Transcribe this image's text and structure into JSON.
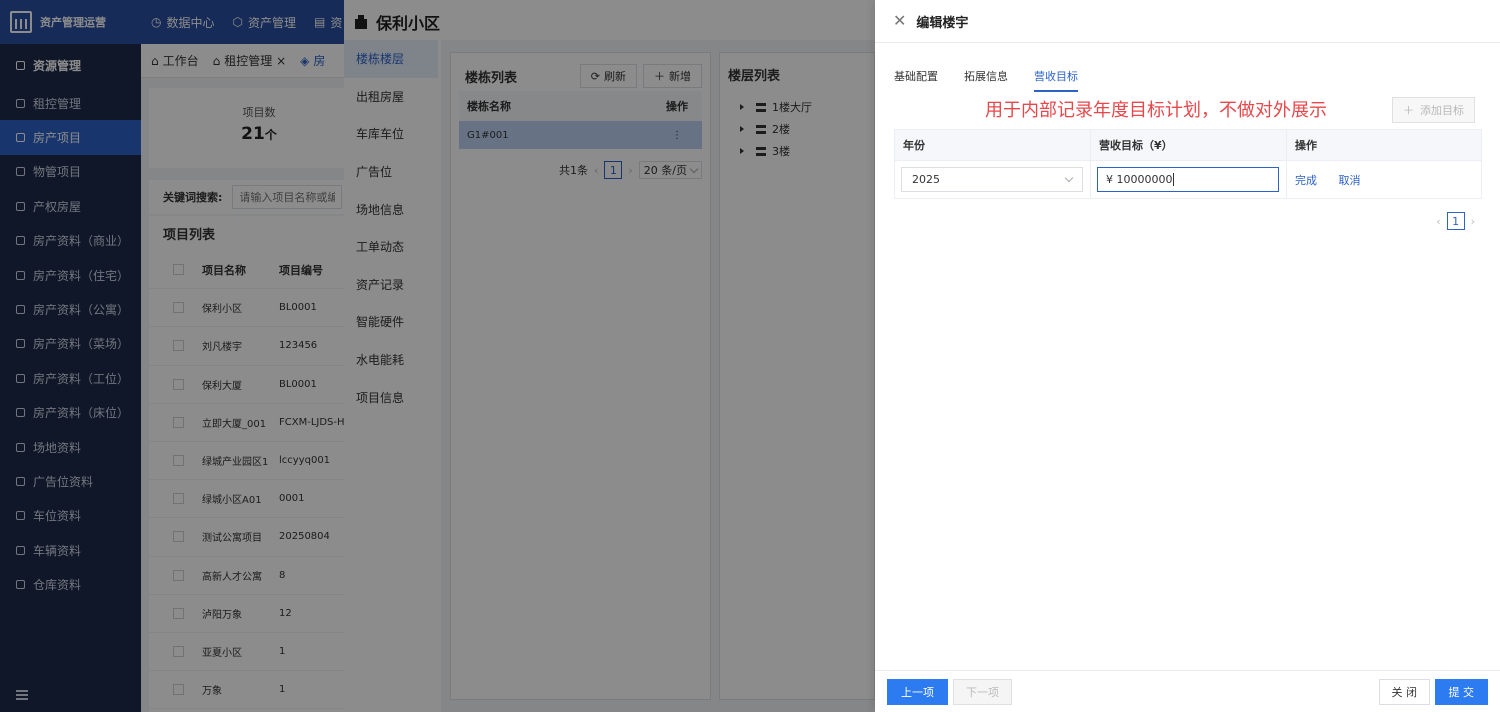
{
  "topbar": {
    "brand": "资产管理运营",
    "nav": [
      "数据中心",
      "资产管理",
      "资"
    ]
  },
  "sidebar": {
    "header": "资源管理",
    "items": [
      {
        "label": "租控管理",
        "active": false
      },
      {
        "label": "房产项目",
        "active": true
      },
      {
        "label": "物管项目",
        "active": false
      },
      {
        "label": "产权房屋",
        "active": false
      },
      {
        "label": "房产资料（商业）",
        "active": false
      },
      {
        "label": "房产资料（住宅）",
        "active": false
      },
      {
        "label": "房产资料（公寓）",
        "active": false
      },
      {
        "label": "房产资料（菜场）",
        "active": false
      },
      {
        "label": "房产资料（工位）",
        "active": false
      },
      {
        "label": "房产资料（床位）",
        "active": false
      },
      {
        "label": "场地资料",
        "active": false
      },
      {
        "label": "广告位资料",
        "active": false
      },
      {
        "label": "车位资料",
        "active": false
      },
      {
        "label": "车辆资料",
        "active": false
      },
      {
        "label": "仓库资料",
        "active": false
      }
    ]
  },
  "content": {
    "tabs": [
      "工作台",
      "租控管理 ×",
      "房"
    ],
    "stats_label": "项目数",
    "stats_value": "21",
    "stats_unit": "个",
    "search_label": "关键词搜索:",
    "search_placeholder": "请输入项目名称或编号",
    "list_title": "项目列表",
    "columns": [
      "项目名称",
      "项目编号"
    ],
    "rows": [
      [
        "保利小区",
        "BL0001"
      ],
      [
        "刘凡楼宇",
        "123456"
      ],
      [
        "保利大厦",
        "BL0001"
      ],
      [
        "立即大厦_001",
        "FCXM-LJDS-HK"
      ],
      [
        "绿城产业园区1",
        "lccyyq001"
      ],
      [
        "绿城小区A01",
        "0001"
      ],
      [
        "测试公寓项目",
        "20250804"
      ],
      [
        "高新人才公寓",
        "8"
      ],
      [
        "泸阳万象",
        "12"
      ],
      [
        "亚夏小区",
        "1"
      ],
      [
        "万象",
        "1"
      ]
    ]
  },
  "midpanel": {
    "title": "保利小区",
    "nav": [
      {
        "label": "楼栋楼层",
        "active": true
      },
      {
        "label": "出租房屋",
        "active": false
      },
      {
        "label": "车库车位",
        "active": false
      },
      {
        "label": "广告位",
        "active": false
      },
      {
        "label": "场地信息",
        "active": false
      },
      {
        "label": "工单动态",
        "active": false
      },
      {
        "label": "资产记录",
        "active": false
      },
      {
        "label": "智能硬件",
        "active": false
      },
      {
        "label": "水电能耗",
        "active": false
      },
      {
        "label": "项目信息",
        "active": false
      }
    ],
    "building_list_title": "楼栋列表",
    "refresh": "刷新",
    "add": "新增",
    "col_name": "楼栋名称",
    "col_op": "操作",
    "building_row": "G1#001",
    "row_op": "⋮",
    "total": "共1条",
    "page": "1",
    "page_size": "20 条/页",
    "floor_list_title": "楼层列表",
    "floors": [
      "1楼大厅",
      "2楼",
      "3楼"
    ]
  },
  "drawer": {
    "title": "编辑楼宇",
    "tabs": [
      {
        "label": "基础配置",
        "active": false
      },
      {
        "label": "拓展信息",
        "active": false
      },
      {
        "label": "营收目标",
        "active": true
      }
    ],
    "annotation": "用于内部记录年度目标计划，不做对外展示",
    "add_target": "添加目标",
    "table_headers": [
      "年份",
      "营收目标（¥）",
      "操作"
    ],
    "row": {
      "year": "2025",
      "amount": "¥ 10000000",
      "done": "完成",
      "cancel": "取消"
    },
    "page": "1",
    "prev": "上一项",
    "next": "下一项",
    "close": "关 闭",
    "submit": "提 交"
  },
  "colors": {
    "primary": "#2d62c8",
    "button_primary": "#2d7bf0",
    "annotation": "#e8474b",
    "sidebar_bg": "#1d2a4a",
    "topbar_bg": "#2a4fa0"
  }
}
